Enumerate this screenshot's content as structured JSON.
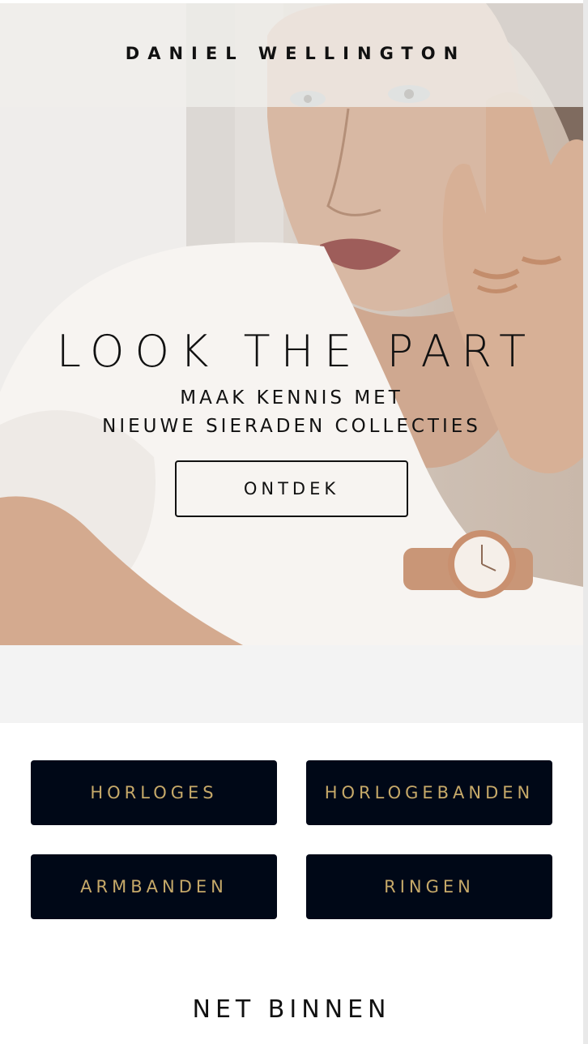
{
  "brand": "DANIEL WELLINGTON",
  "hero": {
    "headline": "LOOK THE PART",
    "subline_1": "MAAK KENNIS MET",
    "subline_2": "NIEUWE SIERADEN COLLECTIES",
    "cta_label": "ONTDEK"
  },
  "categories": [
    {
      "label": "HORLOGES"
    },
    {
      "label": "HORLOGEBANDEN"
    },
    {
      "label": "ARMBANDEN"
    },
    {
      "label": "RINGEN"
    }
  ],
  "section": {
    "title": "NET BINNEN"
  },
  "colors": {
    "button_bg": "#000817",
    "button_text": "#c6a969",
    "band": "#f3f3f3"
  }
}
